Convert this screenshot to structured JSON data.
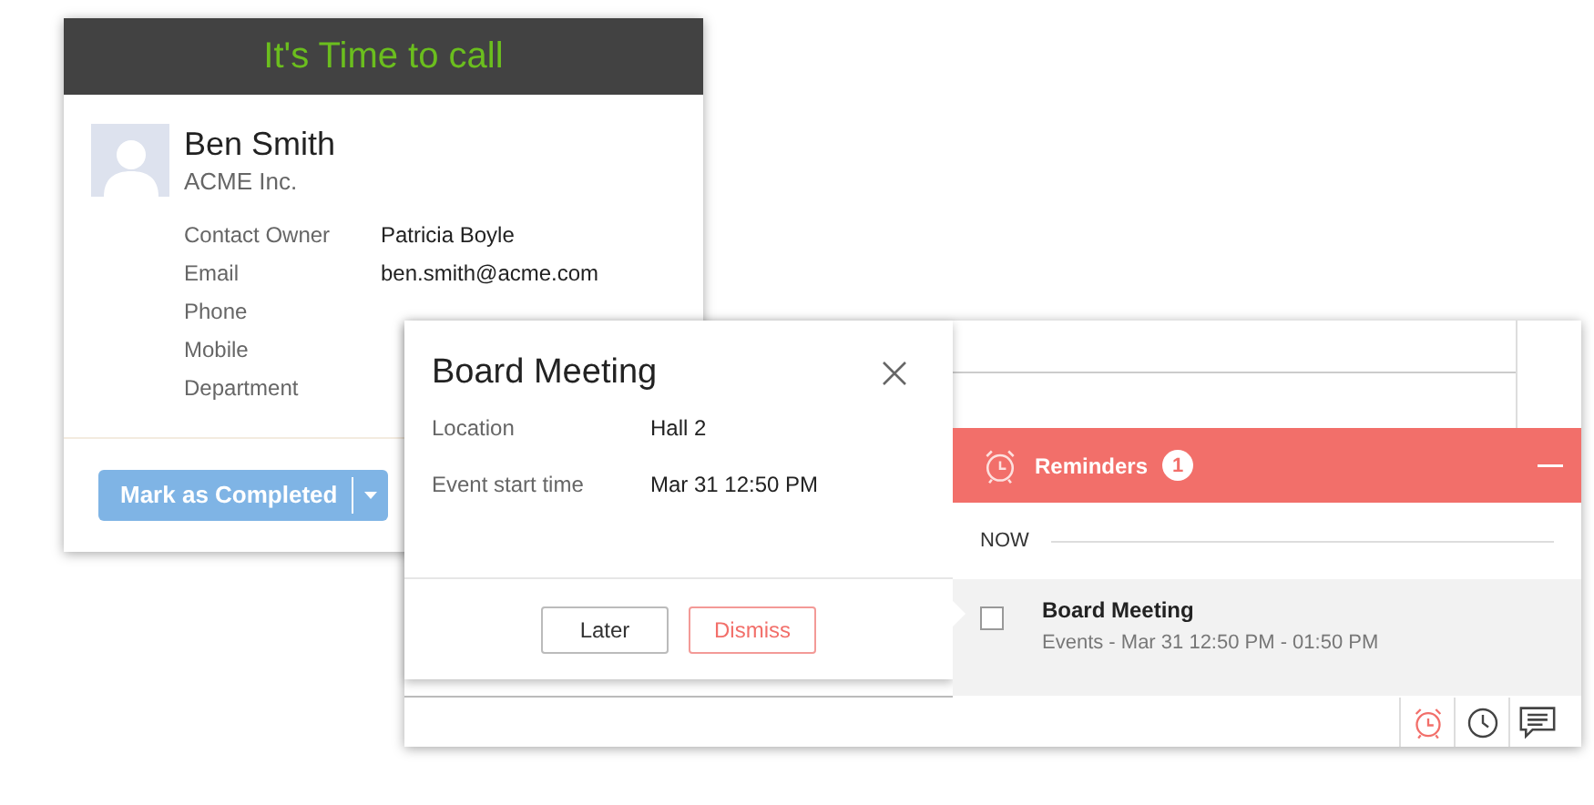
{
  "call_card": {
    "title": "It's Time to call",
    "name": "Ben Smith",
    "company": "ACME Inc.",
    "fields": [
      {
        "label": "Contact Owner",
        "value": "Patricia Boyle"
      },
      {
        "label": "Email",
        "value": "ben.smith@acme.com"
      },
      {
        "label": "Phone"
      },
      {
        "label": "Mobile"
      },
      {
        "label": "Department"
      }
    ],
    "button": "Mark as Completed"
  },
  "event_popup": {
    "heading": "Board Meeting",
    "fields": [
      {
        "label": "Location",
        "value": "Hall 2"
      },
      {
        "label": "Event start time",
        "value": "Mar 31 12:50 PM"
      }
    ],
    "buttons": [
      {
        "label": "Later",
        "kind": "secondary"
      },
      {
        "label": "Dismiss",
        "kind": "danger"
      }
    ]
  },
  "reminders": {
    "title": "Reminders",
    "count": "1",
    "section": "NOW",
    "items": [
      {
        "title": "Board Meeting",
        "detail": "Events - Mar 31 12:50 PM - 01:50 PM",
        "checked": false
      }
    ]
  },
  "toolbar": [
    {
      "kind": "alarm",
      "selected": true
    },
    {
      "kind": "clock",
      "selected": false
    },
    {
      "kind": "chat",
      "selected": false
    }
  ]
}
